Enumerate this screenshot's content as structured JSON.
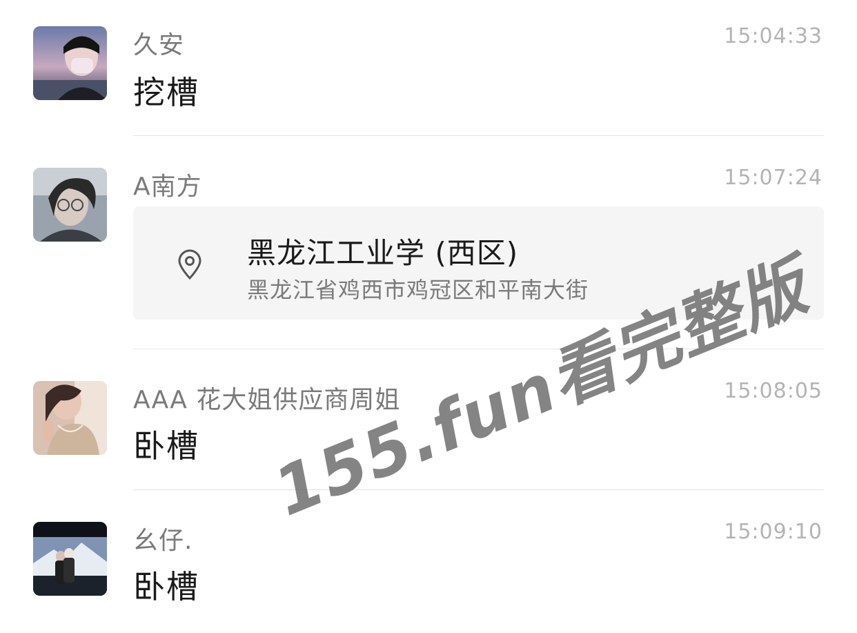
{
  "messages": [
    {
      "sender": "久安",
      "time": "15:04:33",
      "text": "挖槽",
      "avatar_icon": "avatar-person-mask-icon"
    },
    {
      "sender": "A南方",
      "time": "15:07:24",
      "location": {
        "name": "黑龙江工业学 (西区)",
        "address": "黑龙江省鸡西市鸡冠区和平南大街",
        "icon": "location-pin-icon"
      },
      "avatar_icon": "avatar-person-glasses-icon"
    },
    {
      "sender": "AAA 花大姐供应商周姐",
      "time": "15:08:05",
      "text": "卧槽",
      "avatar_icon": "avatar-person-necklace-icon"
    },
    {
      "sender": "幺仔.",
      "time": "15:09:10",
      "text": "卧槽",
      "avatar_icon": "avatar-couple-mountain-icon"
    }
  ],
  "watermark": "155.fun看完整版",
  "colors": {
    "background": "#ffffff",
    "sender_text": "#7a7a7a",
    "timestamp_text": "#b3b3b3",
    "message_text": "#1a1a1a",
    "divider": "#e3e3e3",
    "card_background": "#f5f5f5"
  }
}
